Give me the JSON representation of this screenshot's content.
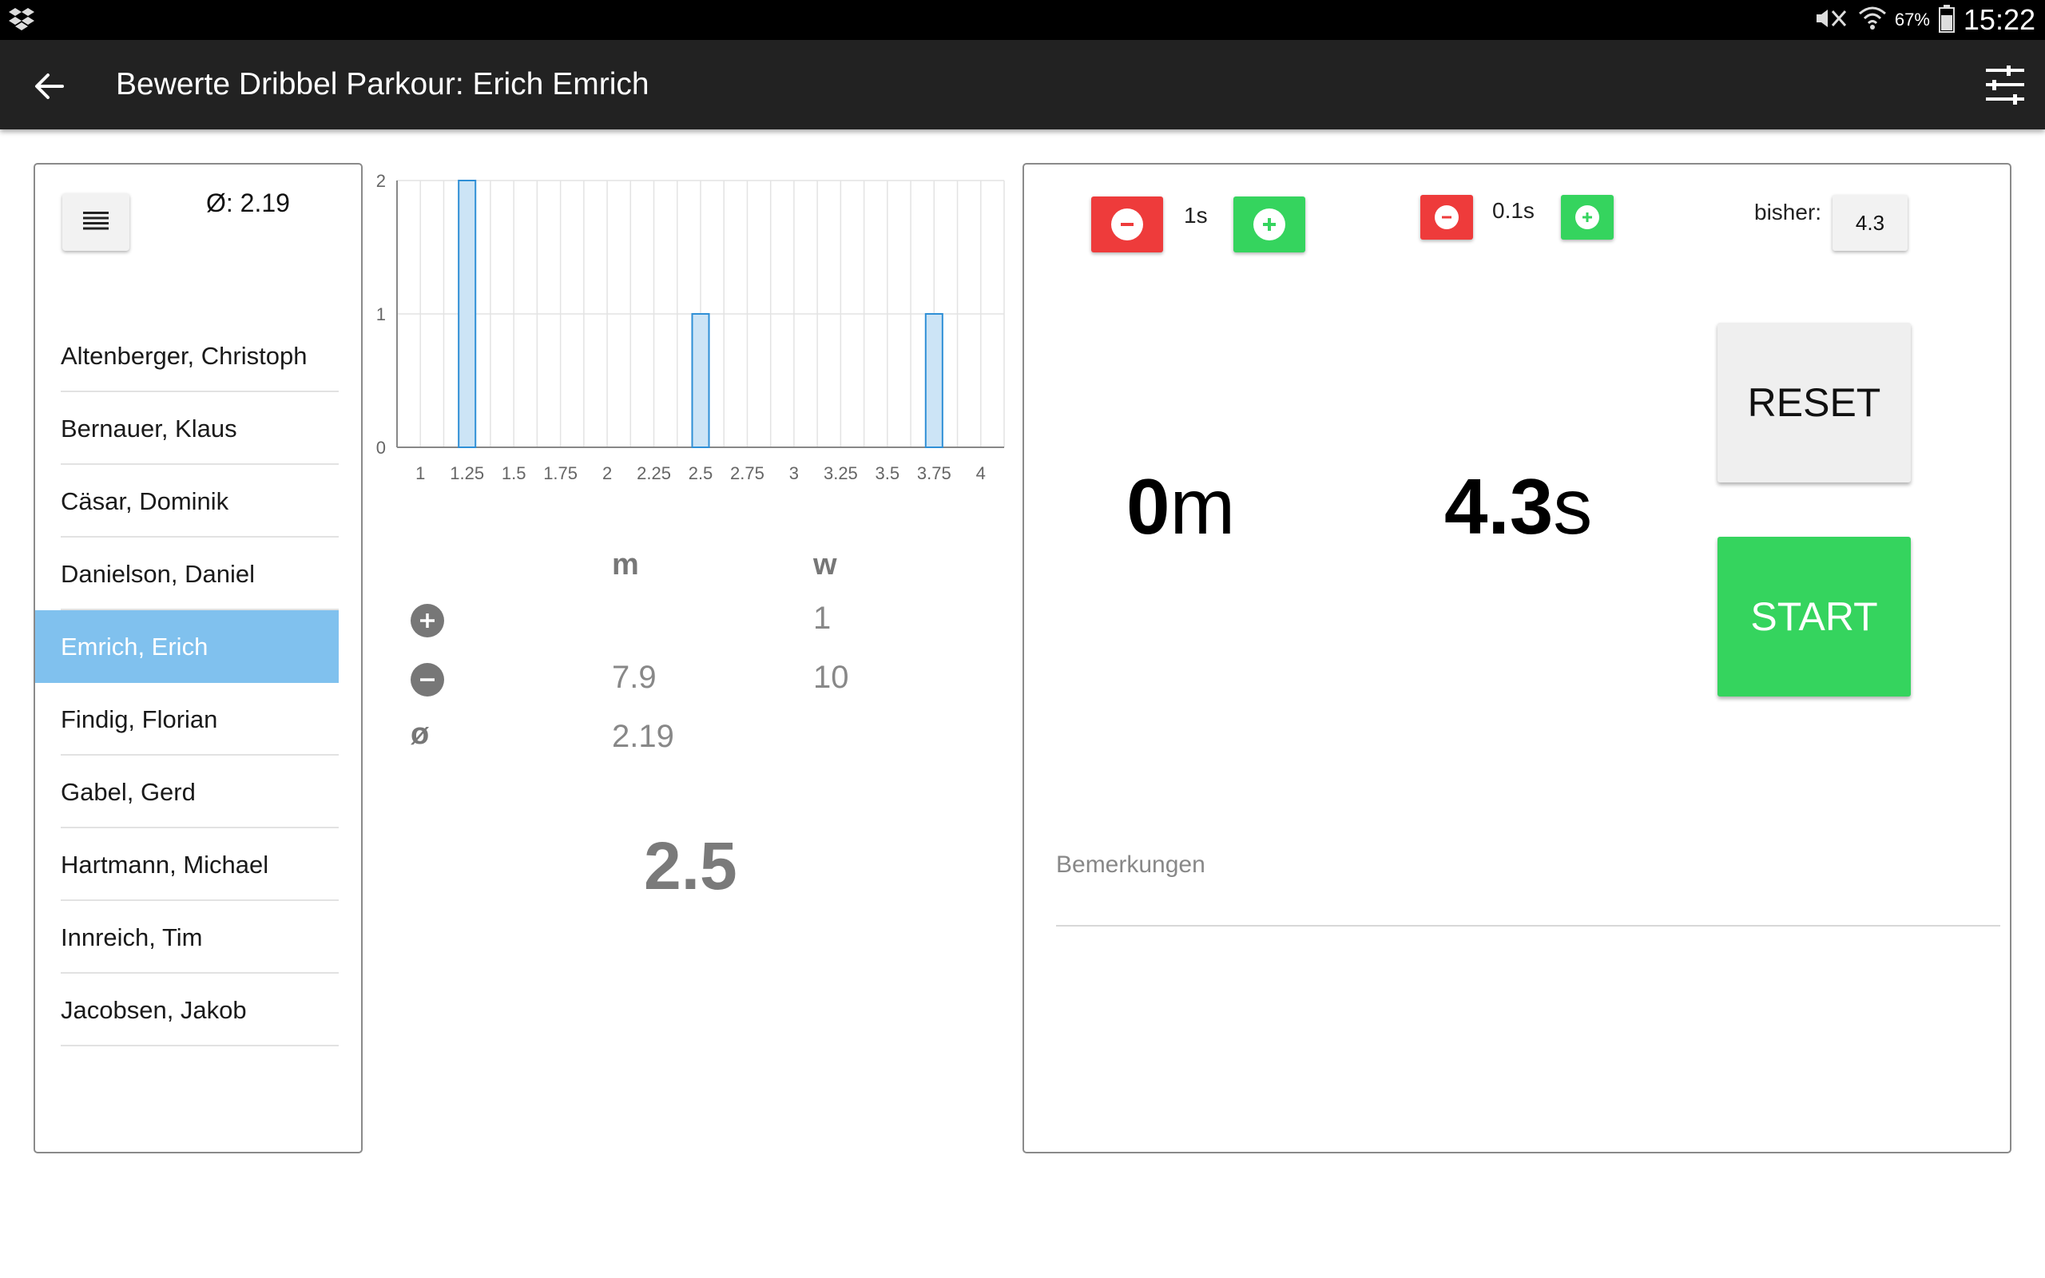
{
  "status_bar": {
    "battery_percent": "67%",
    "time": "15:22"
  },
  "app_bar": {
    "title": "Bewerte Dribbel Parkour: Erich Emrich"
  },
  "left_panel": {
    "average": "Ø: 2.19",
    "players": [
      "Altenberger, Christoph",
      "Bernauer, Klaus",
      "Cäsar, Dominik",
      "Danielson, Daniel",
      "Emrich, Erich",
      "Findig, Florian",
      "Gabel, Gerd",
      "Hartmann, Michael",
      "Innreich, Tim",
      "Jacobsen, Jakob"
    ],
    "selected_index": 4
  },
  "chart_data": {
    "type": "bar",
    "x_ticks": [
      "1",
      "1.25",
      "1.5",
      "1.75",
      "2",
      "2.25",
      "2.5",
      "2.75",
      "3",
      "3.25",
      "3.5",
      "3.75",
      "4"
    ],
    "y_ticks": [
      "0",
      "1",
      "2"
    ],
    "bars": [
      {
        "x": 1.25,
        "y": 2
      },
      {
        "x": 2.5,
        "y": 1
      },
      {
        "x": 3.75,
        "y": 1
      }
    ],
    "xlim": [
      0.875,
      4.125
    ],
    "ylim": [
      0,
      2
    ],
    "grid": true,
    "colors": {
      "bar_fill": "#cce4f6",
      "bar_stroke": "#2f8fd6",
      "grid": "#e3e3e3",
      "axis": "#888888",
      "tick_text": "#666666"
    }
  },
  "stats": {
    "col_m": "m",
    "col_w": "w",
    "plus_m": "",
    "plus_w": "1",
    "minus_m": "7.9",
    "minus_w": "10",
    "avg_symbol": "ø",
    "avg_m": "2.19",
    "score": "2.5"
  },
  "controls": {
    "step1_label": "1s",
    "step2_label": "0.1s",
    "bisher_label": "bisher:",
    "bisher_value": "4.3",
    "reset_label": "RESET",
    "start_label": "START",
    "distance_value": "0",
    "distance_unit": "m",
    "time_value": "4.3",
    "time_unit": "s",
    "remarks_placeholder": "Bemerkungen"
  },
  "colors": {
    "accent_blue": "#80c1ee",
    "start_green": "#35d45e",
    "minus_red": "#ee3b3b",
    "appbar": "#222222"
  }
}
